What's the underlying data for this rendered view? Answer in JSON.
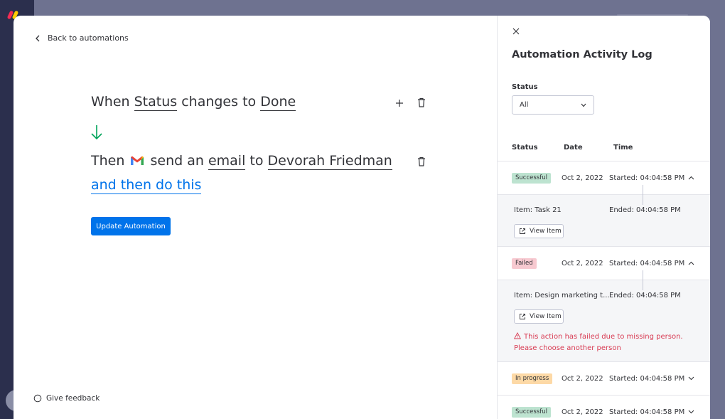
{
  "left": {
    "back_label": "Back to automations",
    "sentence1": {
      "when": "When",
      "status": "Status",
      "changes_to": "changes to",
      "done": "Done"
    },
    "sentence2": {
      "then": "Then",
      "send_an": "send an",
      "email": "email",
      "to": "to",
      "person": "Devorah Friedman"
    },
    "sentence3": {
      "and_then": "and then do this"
    },
    "update_label": "Update Automation",
    "feedback_label": "Give feedback"
  },
  "log": {
    "title": "Automation Activity Log",
    "status_label": "Status",
    "status_value": "All",
    "columns": {
      "status": "Status",
      "date": "Date",
      "time": "Time"
    },
    "rows": [
      {
        "status": "Successful",
        "date": "Oct 2, 2022",
        "started": "Started: 04:04:58 PM",
        "item": "Item: Task 21",
        "ended": "Ended: 04:04:58 PM",
        "view": "View Item"
      },
      {
        "status": "Failed",
        "date": "Oct 2, 2022",
        "started": "Started: 04:04:58 PM",
        "item": "Item: Design marketing t...",
        "ended": "Ended: 04:04:58 PM",
        "view": "View Item",
        "error1": "This action has failed due to missing person.",
        "error2": "Please choose another person"
      },
      {
        "status": "In progress",
        "date": "Oct 2, 2022",
        "started": "Started: 04:04:58 PM"
      },
      {
        "status": "Successful",
        "date": "Oct 2, 2022",
        "started": "Started: 04:04:58 PM"
      }
    ]
  },
  "colors": {
    "primary": "#0073ea",
    "success": "#bde3d0",
    "failed": "#f7c9d0",
    "progress": "#fdd9a6",
    "error_text": "#d83a52",
    "arrow": "#00a359"
  }
}
